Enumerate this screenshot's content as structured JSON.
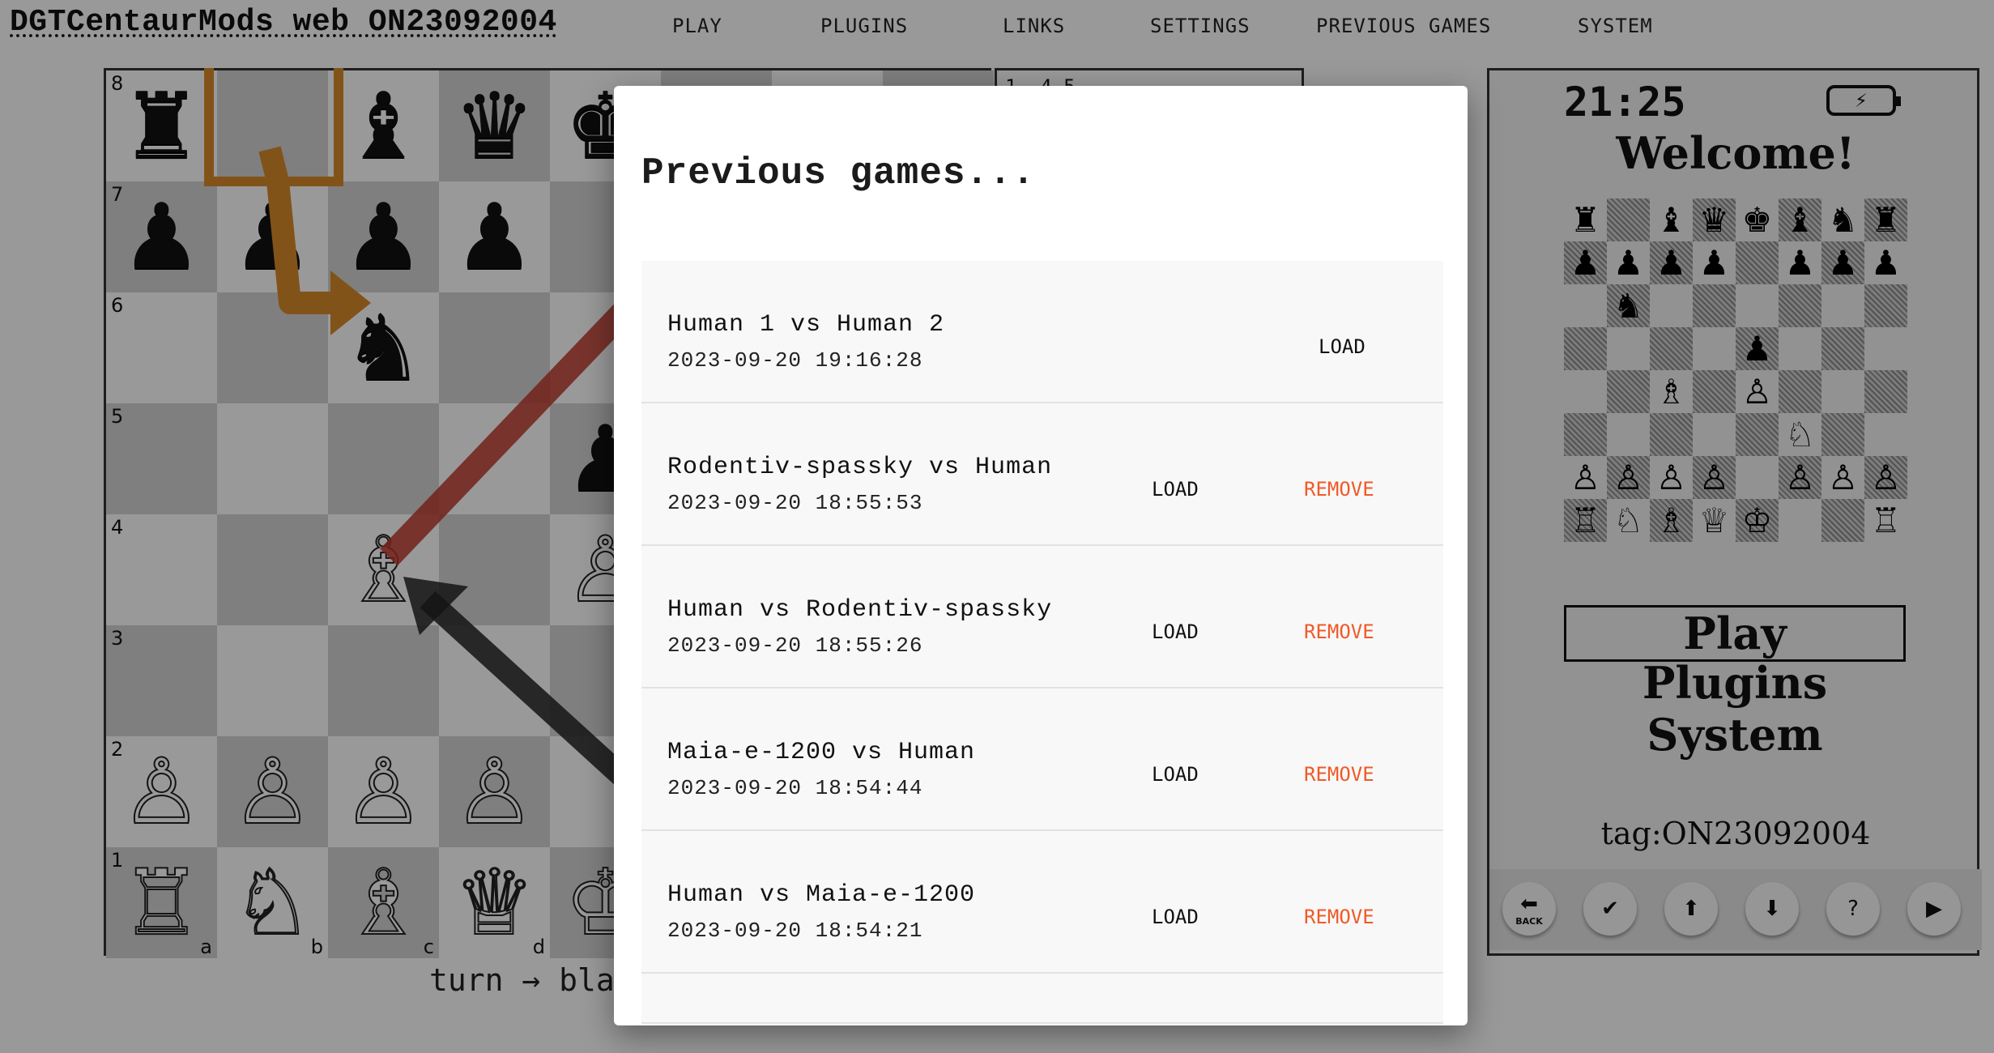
{
  "header": {
    "brand": "DGTCentaurMods web ON23092004",
    "nav": [
      "PLAY",
      "PLUGINS",
      "LINKS",
      "SETTINGS",
      "PREVIOUS GAMES",
      "SYSTEM"
    ]
  },
  "board": {
    "ranks": [
      "8",
      "7",
      "6",
      "5",
      "4",
      "3",
      "2",
      "1"
    ],
    "files": [
      "a",
      "b",
      "c",
      "d"
    ],
    "rows": [
      [
        "♜",
        "",
        "♝",
        "♛",
        "♚",
        "",
        "",
        ""
      ],
      [
        "♟",
        "♟",
        "♟",
        "♟",
        "",
        "",
        "",
        ""
      ],
      [
        "",
        "",
        "♞",
        "",
        "",
        "",
        "",
        ""
      ],
      [
        "",
        "",
        "",
        "",
        "♟",
        "",
        "",
        ""
      ],
      [
        "",
        "",
        "♗",
        "",
        "♙",
        "",
        "",
        ""
      ],
      [
        "",
        "",
        "",
        "",
        "",
        "",
        "",
        ""
      ],
      [
        "♙",
        "♙",
        "♙",
        "♙",
        "",
        "",
        "",
        ""
      ],
      [
        "♖",
        "♘",
        "♗",
        "♕",
        "♔",
        "",
        "",
        ""
      ]
    ],
    "turn_text": "turn → bla"
  },
  "moves": {
    "text": "1.   4    5"
  },
  "epaper": {
    "time": "21:25",
    "battery_icon": "battery-charging-icon",
    "welcome": "Welcome!",
    "board_rows": [
      "♜.♝♛♚♝♞♜",
      "♟♟♟♟.♟♟♟",
      ".♞......",
      "....♟...",
      "..♗.♙...",
      ".....♘..",
      "♙♙♙♙.♙♙♙",
      "♖♘♗♕♔..♖"
    ],
    "menu": [
      "Play",
      "Plugins",
      "System"
    ],
    "tag": "tag:ON23092004",
    "buttons": [
      {
        "icon": "back-icon",
        "glyph": "⬅",
        "label": "BACK"
      },
      {
        "icon": "check-icon",
        "glyph": "✔",
        "label": ""
      },
      {
        "icon": "arrow-up-icon",
        "glyph": "⬆",
        "label": ""
      },
      {
        "icon": "arrow-down-icon",
        "glyph": "⬇",
        "label": ""
      },
      {
        "icon": "help-icon",
        "glyph": "?",
        "label": ""
      },
      {
        "icon": "play-icon",
        "glyph": "▶",
        "label": ""
      }
    ]
  },
  "modal": {
    "title": "Previous games...",
    "load_label": "LOAD",
    "remove_label": "REMOVE",
    "accent_color": "#f05a28",
    "games": [
      {
        "name": "Human 1 vs Human 2",
        "date": "2023-09-20 19:16:28",
        "removable": false
      },
      {
        "name": "Rodentiv-spassky vs Human",
        "date": "2023-09-20 18:55:53",
        "removable": true
      },
      {
        "name": "Human vs Rodentiv-spassky",
        "date": "2023-09-20 18:55:26",
        "removable": true
      },
      {
        "name": "Maia-e-1200 vs Human",
        "date": "2023-09-20 18:54:44",
        "removable": true
      },
      {
        "name": "Human vs Maia-e-1200",
        "date": "2023-09-20 18:54:21",
        "removable": true
      }
    ]
  }
}
